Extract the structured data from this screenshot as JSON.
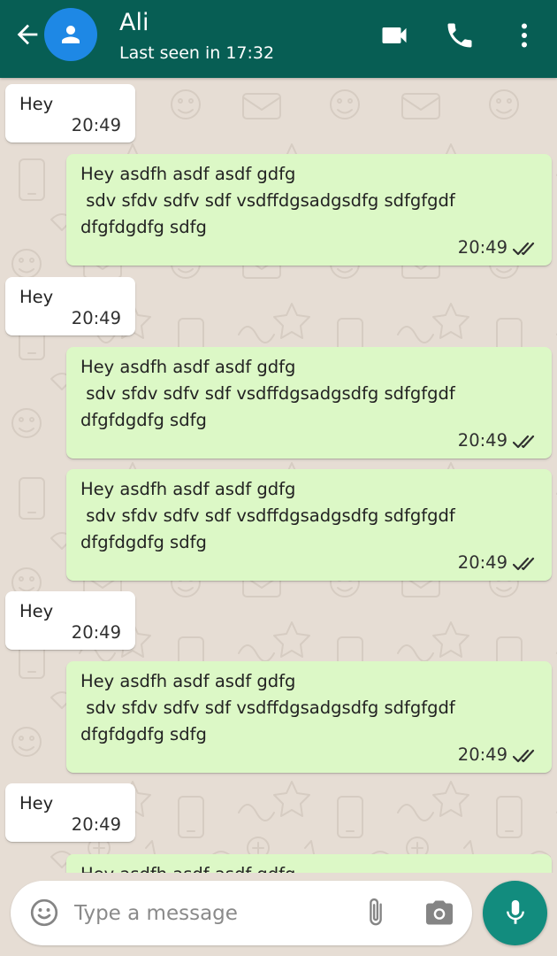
{
  "header": {
    "contact_name": "Ali",
    "status": "Last seen in 17:32",
    "icons": [
      "back-arrow-icon",
      "person-icon",
      "video-call-icon",
      "voice-call-icon",
      "more-vert-icon"
    ],
    "color": "#075e54"
  },
  "messages": [
    {
      "direction": "incoming",
      "text": "Hey",
      "time": "20:49"
    },
    {
      "direction": "outgoing",
      "text": "Hey asdfh asdf asdf gdfg\n sdv sfdv sdfv sdf vsdffdgsadgsdfg sdfgfgdf\ndfgfdgdfg sdfg",
      "time": "20:49",
      "status": "read"
    },
    {
      "direction": "incoming",
      "text": "Hey",
      "time": "20:49"
    },
    {
      "direction": "outgoing",
      "text": "Hey asdfh asdf asdf gdfg\n sdv sfdv sdfv sdf vsdffdgsadgsdfg sdfgfgdf\ndfgfdgdfg sdfg",
      "time": "20:49",
      "status": "read"
    },
    {
      "direction": "outgoing",
      "text": "Hey asdfh asdf asdf gdfg\n sdv sfdv sdfv sdf vsdffdgsadgsdfg sdfgfgdf\ndfgfdgdfg sdfg",
      "time": "20:49",
      "status": "read"
    },
    {
      "direction": "incoming",
      "text": "Hey",
      "time": "20:49"
    },
    {
      "direction": "outgoing",
      "text": "Hey asdfh asdf asdf gdfg\n sdv sfdv sdfv sdf vsdffdgsadgsdfg sdfgfgdf\ndfgfdgdfg sdfg",
      "time": "20:49",
      "status": "read"
    },
    {
      "direction": "incoming",
      "text": "Hey",
      "time": "20:49"
    },
    {
      "direction": "outgoing",
      "text": "Hey asdfh asdf asdf gdfg",
      "time": "",
      "status": "partially-visible"
    }
  ],
  "composer": {
    "placeholder": "Type a message",
    "value": "",
    "icons": [
      "emoji-icon",
      "attach-icon",
      "camera-icon",
      "mic-icon"
    ]
  },
  "colors": {
    "header": "#075e54",
    "outgoing_bubble": "#dcf8c6",
    "incoming_bubble": "#ffffff",
    "chat_background": "#e6ddd4",
    "mic_button": "#128c7e",
    "avatar": "#1e88e5",
    "read_ticks": "#303030"
  }
}
